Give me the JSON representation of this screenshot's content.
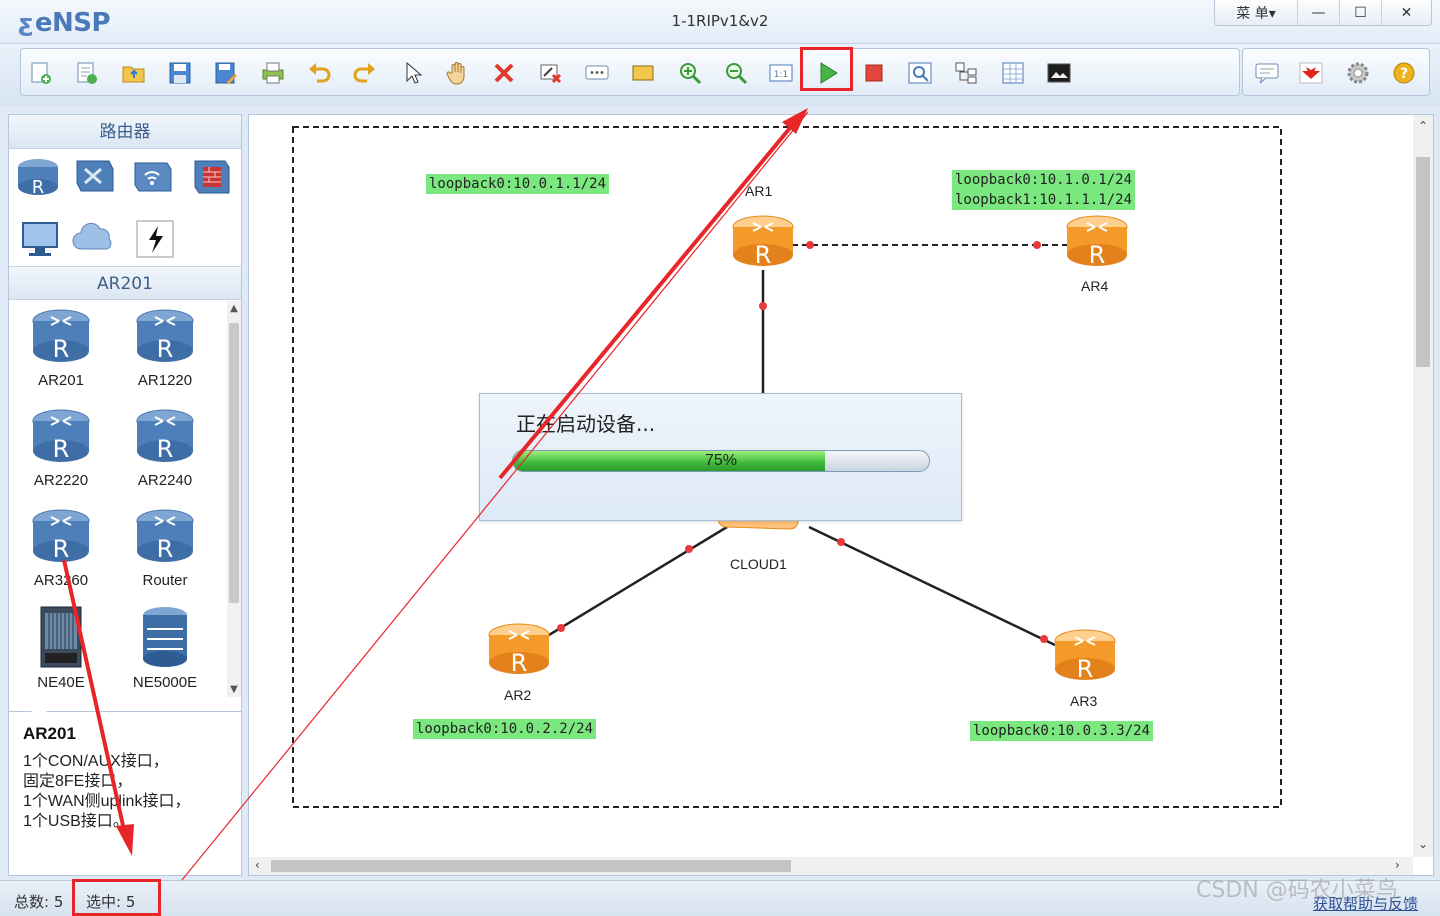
{
  "window": {
    "app_name": "eNSP",
    "title": "1-1RIPv1&v2",
    "menu_label": "菜 单▾",
    "minimize": "—",
    "maximize": "☐",
    "close": "✕"
  },
  "toolbar": {
    "icons": [
      "new-topology-icon",
      "new-example-icon",
      "open-icon",
      "save-icon",
      "save-as-icon",
      "print-icon",
      "undo-icon",
      "redo-icon",
      "select-pointer-icon",
      "pan-hand-icon",
      "delete-icon",
      "delete-link-icon",
      "add-text-icon",
      "add-shape-icon",
      "zoom-in-icon",
      "zoom-out-icon",
      "fit-view-icon",
      "start-device-icon",
      "stop-device-icon",
      "capture-data-icon",
      "topology-grid-icon",
      "show-interfaces-icon",
      "screenshot-icon"
    ],
    "right_icons": [
      "chat-icon",
      "huawei-logo-icon",
      "settings-gear-icon",
      "help-icon"
    ]
  },
  "left_panel": {
    "category_title": "路由器",
    "categories": [
      "router-category-icon",
      "switch-category-icon",
      "wireless-category-icon",
      "firewall-category-icon",
      "pc-category-icon",
      "cloud-category-icon",
      "link-category-icon"
    ],
    "model_title": "AR201",
    "devices": [
      "AR201",
      "AR1220",
      "AR2220",
      "AR2240",
      "AR3260",
      "Router",
      "NE40E",
      "NE5000E"
    ],
    "description": {
      "title": "AR201",
      "lines": [
        "1个CON/AUX接口，",
        "固定8FE接口，",
        "1个WAN侧uplink接口，",
        "1个USB接口。"
      ]
    }
  },
  "topology": {
    "nodes": {
      "ar1": "AR1",
      "ar2": "AR2",
      "ar3": "AR3",
      "ar4": "AR4",
      "cloud1": "CLOUD1"
    },
    "labels": {
      "ar1_loopback": "loopback0:10.0.1.1/24",
      "ar4_loopback0": "loopback0:10.1.0.1/24",
      "ar4_loopback1": "loopback1:10.1.1.1/24",
      "ar2_loopback": "loopback0:10.0.2.2/24",
      "ar3_loopback": "loopback0:10.0.3.3/24"
    }
  },
  "progress": {
    "message": "正在启动设备...",
    "percent_label": "75%",
    "value": 0.75
  },
  "status": {
    "total": "总数: 5",
    "selected": "选中: 5",
    "help": "获取帮助与反馈"
  },
  "watermark": "CSDN @码农小菜鸟",
  "colors": {
    "accent": "#4a78b8",
    "highlight_red": "#e8262a",
    "router_orange": "#f39a2a",
    "label_green": "#7be87f"
  }
}
